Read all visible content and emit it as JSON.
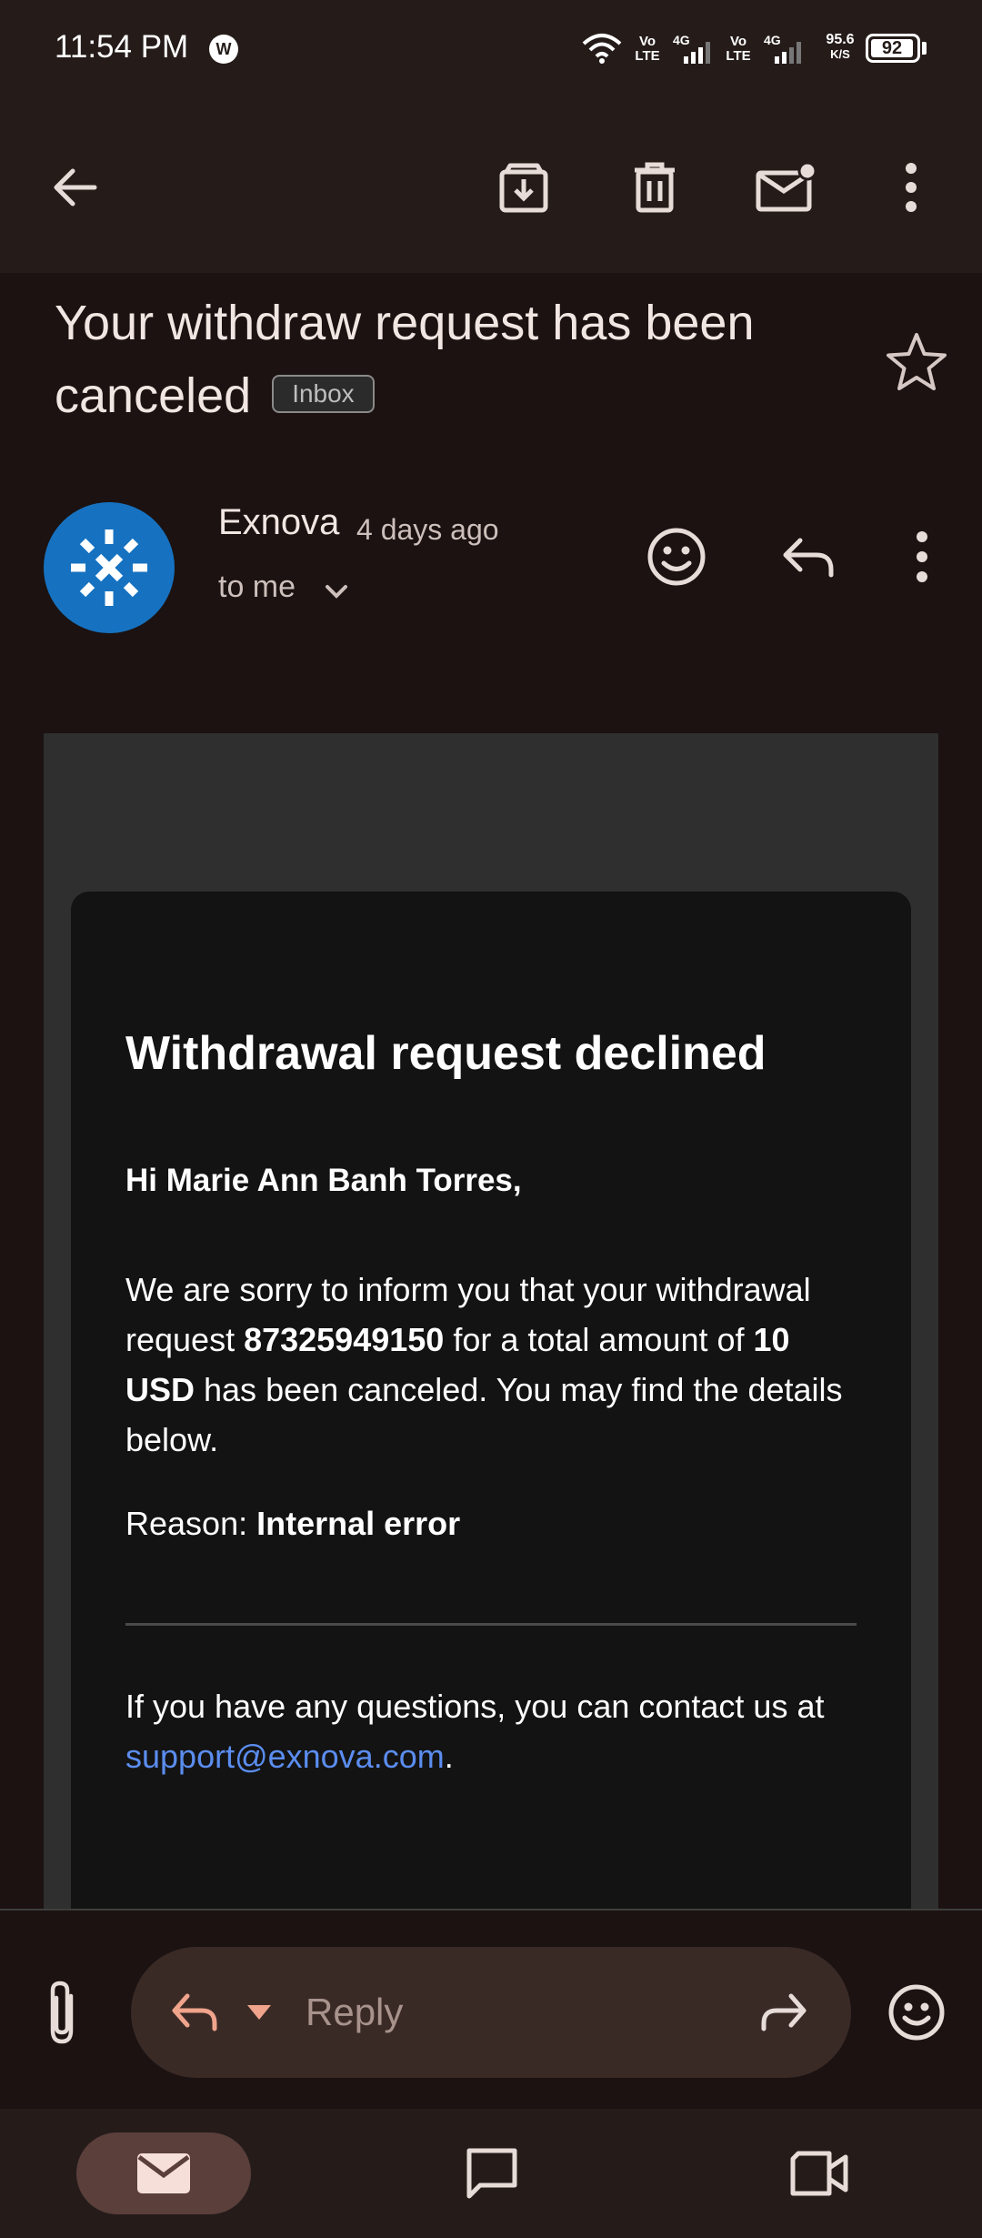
{
  "status_bar": {
    "time": "11:54 PM",
    "notif_badge": "W",
    "net1_top": "Vo",
    "net1_bottom": "LTE",
    "net1_gen": "4G",
    "net2_top": "Vo",
    "net2_bottom": "LTE",
    "net2_gen": "4G",
    "speed_value": "95.6",
    "speed_unit": "K/S",
    "battery": "92"
  },
  "toolbar": {
    "icons": [
      "back-arrow-icon",
      "archive-icon",
      "delete-icon",
      "mark-unread-icon",
      "more-vert-icon"
    ]
  },
  "email": {
    "subject": "Your withdraw request has been canceled",
    "label": "Inbox",
    "starred": false,
    "sender_name": "Exnova",
    "time": "4 days ago",
    "recipient": "to me",
    "body": {
      "title": "Withdrawal request declined",
      "greeting": "Hi Marie Ann Banh Torres,",
      "p1_a": "We are sorry to inform you that your withdrawal request ",
      "p1_request_id": "87325949150",
      "p1_b": " for a total amount of ",
      "p1_amount": "10 USD",
      "p1_c": " has been canceled. You may find the details below.",
      "reason_label": "Reason: ",
      "reason_value": "Internal error",
      "contact_text": "If you have any questions, you can contact us at ",
      "contact_email": "support@exnova.com",
      "contact_end": "."
    }
  },
  "reply_bar": {
    "placeholder": "Reply"
  },
  "bottom_nav": {
    "items": [
      "mail-icon",
      "chat-icon",
      "meet-icon"
    ],
    "active": "mail-icon"
  },
  "colors": {
    "background": "#1b1211",
    "toolbar": "#251c1a",
    "accent": "#f0a48c",
    "avatar": "#1672c0",
    "link": "#5b8def"
  }
}
